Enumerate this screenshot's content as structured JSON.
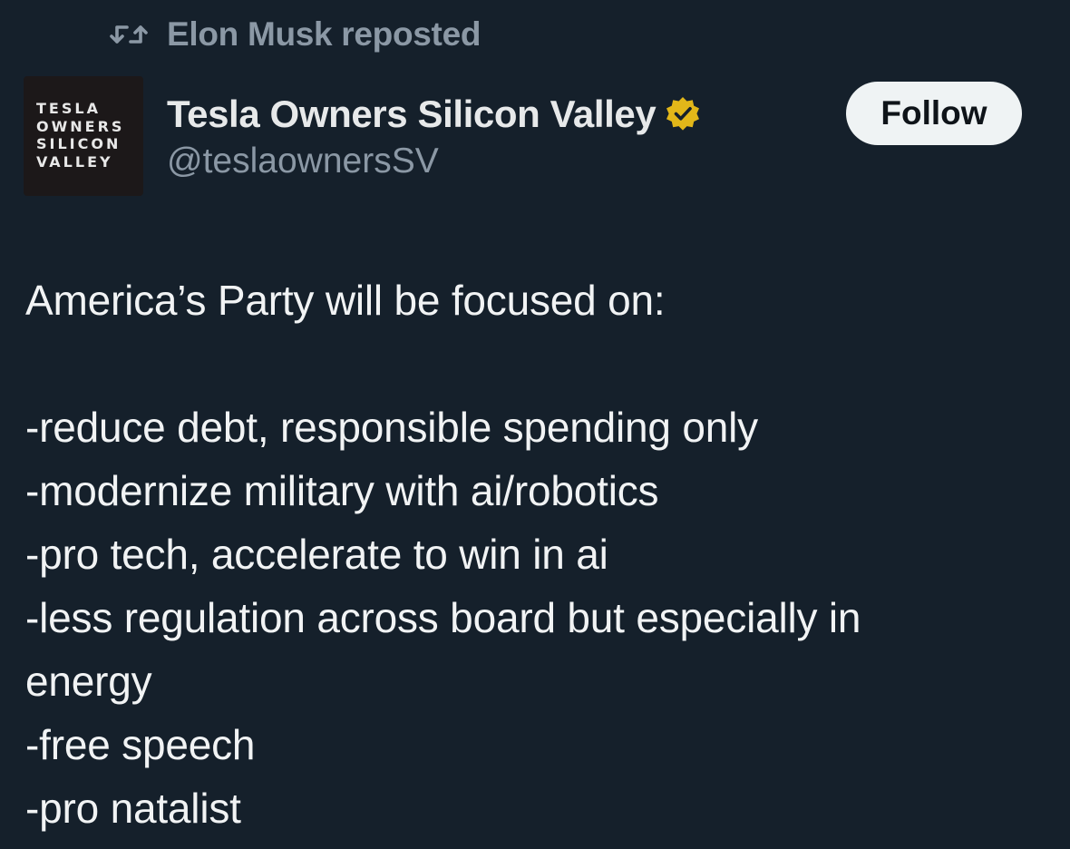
{
  "repost": {
    "icon": "repost-icon",
    "text": "Elon Musk reposted"
  },
  "author": {
    "avatar_lines": [
      "TESLA",
      "OWNERS",
      "SILICON",
      "VALLEY"
    ],
    "display_name": "Tesla Owners Silicon Valley",
    "verified_icon": "verified-badge-icon",
    "verified_color": "#e2b719",
    "handle": "@teslaownersSV"
  },
  "follow": {
    "label": "Follow"
  },
  "tweet": {
    "intro": "America’s Party will be focused on:",
    "points": [
      "-reduce debt, responsible spending only",
      "-modernize military with ai/robotics",
      "-pro tech, accelerate to win in ai",
      "-less regulation across board but especially in",
      "energy",
      "-free speech",
      "-pro natalist"
    ]
  },
  "colors": {
    "background": "#15202b",
    "text": "#e7e9ea",
    "secondary": "#8b98a5",
    "follow_bg": "#eff3f4"
  }
}
